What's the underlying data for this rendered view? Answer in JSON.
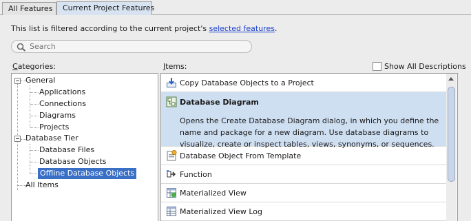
{
  "tabs": [
    {
      "label": "All Features"
    },
    {
      "label": "Current Project Features"
    }
  ],
  "filter_note": {
    "text": "This list is filtered according to the current project's ",
    "link": "selected features",
    "suffix": "."
  },
  "search": {
    "placeholder": "Search"
  },
  "categories": {
    "header_key": "C",
    "header_rest": "ategories:",
    "tree": {
      "general": "General",
      "applications": "Applications",
      "connections": "Connections",
      "diagrams": "Diagrams",
      "projects": "Projects",
      "database_tier": "Database Tier",
      "database_files": "Database Files",
      "database_objects": "Database Objects",
      "offline_database_objects": "Offline Database Objects",
      "all_items": "All Items"
    }
  },
  "items": {
    "header_key": "I",
    "header_rest": "tems:",
    "show_all_label": "Show All Descriptions",
    "list": [
      {
        "label": "Copy Database Objects to a Project",
        "icon": "download-arrow-icon"
      },
      {
        "label": "Database Diagram",
        "icon": "database-diagram-icon",
        "description": "Opens the Create Database Diagram dialog, in which you define the name and package for a new diagram. Use database diagrams to visualize, create or inspect tables, views, synonyms, or sequences."
      },
      {
        "label": "Database Object From Template",
        "icon": "template-icon"
      },
      {
        "label": "Function",
        "icon": "function-icon"
      },
      {
        "label": "Materialized View",
        "icon": "materialized-view-icon"
      },
      {
        "label": "Materialized View Log",
        "icon": "materialized-view-log-icon"
      }
    ]
  }
}
